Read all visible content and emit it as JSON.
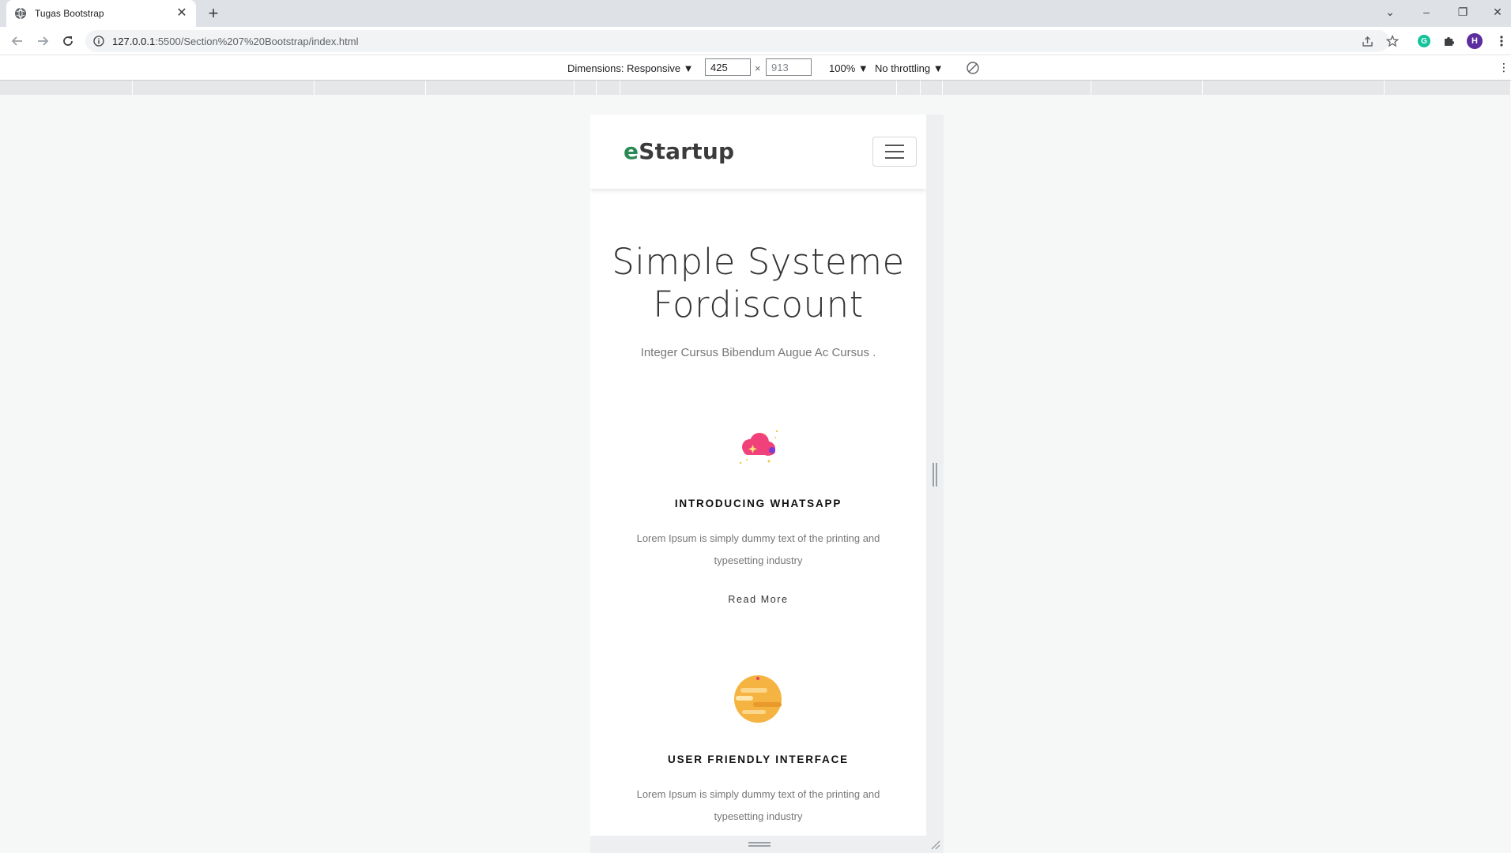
{
  "browser": {
    "tab_title": "Tugas Bootstrap",
    "url_host": "127.0.0.1",
    "url_path": ":5500/Section%207%20Bootstrap/index.html",
    "profile_initial": "H"
  },
  "devtools": {
    "dimensions_label": "Dimensions: Responsive ▼",
    "width_value": "425",
    "height_value": "913",
    "times": "×",
    "zoom_label": "100% ▼",
    "throttle_label": "No throttling ▼"
  },
  "site": {
    "brand_first": "e",
    "brand_rest": "Startup",
    "hero_title": "Simple Systeme Fordiscount",
    "hero_subtitle": "Integer Cursus Bibendum Augue Ac Cursus .",
    "features": [
      {
        "title": "INTRODUCING WHATSAPP",
        "text": "Lorem Ipsum is simply dummy text of the printing and typesetting industry",
        "link": "Read More"
      },
      {
        "title": "USER FRIENDLY INTERFACE",
        "text": "Lorem Ipsum is simply dummy text of the printing and typesetting industry"
      }
    ]
  },
  "icons": [
    "globe-icon",
    "close-icon",
    "plus-icon",
    "back-arrow-icon",
    "forward-arrow-icon",
    "reload-icon",
    "info-icon",
    "share-icon",
    "star-icon",
    "puzzle-icon",
    "kebab-menu-icon",
    "rotate-icon",
    "hamburger-icon",
    "cloud-icon",
    "planet-icon"
  ],
  "colors": {
    "brand_accent": "#2a8a56",
    "cloud_pink": "#f0417b",
    "planet_orange": "#f5b441",
    "page_bg": "#f6f7f7"
  }
}
